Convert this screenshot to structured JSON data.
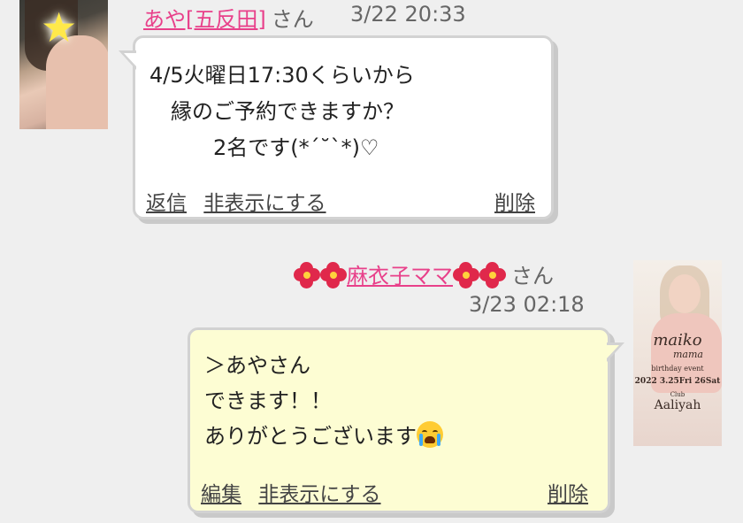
{
  "messages": [
    {
      "sender_name": "あや[五反田]",
      "honorific": "さん",
      "timestamp": "3/22 20:33",
      "body_lines": [
        "4/5火曜日17:30くらいから",
        "　縁のご予約できますか？",
        "　　　2名です(*´˘`*)♡"
      ],
      "actions": [
        "返信",
        "非表示にする"
      ],
      "delete_label": "削除",
      "avatar": "profile-photo-with-star-sticker",
      "bubble_color": "#ffffff"
    },
    {
      "sender_name": "麻衣子ママ",
      "honorific": "さん",
      "timestamp": "3/23 02:18",
      "body_lines": [
        "＞あやさん",
        "できます！！",
        "ありがとうございます"
      ],
      "actions": [
        "編集",
        "非表示にする"
      ],
      "delete_label": "削除",
      "avatar": "event-poster",
      "avatar_text": {
        "t1": "maiko",
        "t2": "mama",
        "t3": "birthday event",
        "t4": "2022  3.25Fri 26Sat",
        "t5": "Club",
        "t6": "Aaliyah"
      },
      "name_decoration_icon": "hibiscus-icon",
      "trailing_emoji": "crying-face-icon",
      "bubble_color": "#fdfdd3"
    }
  ],
  "colors": {
    "name_link": "#e8408a",
    "background": "#efefef"
  }
}
